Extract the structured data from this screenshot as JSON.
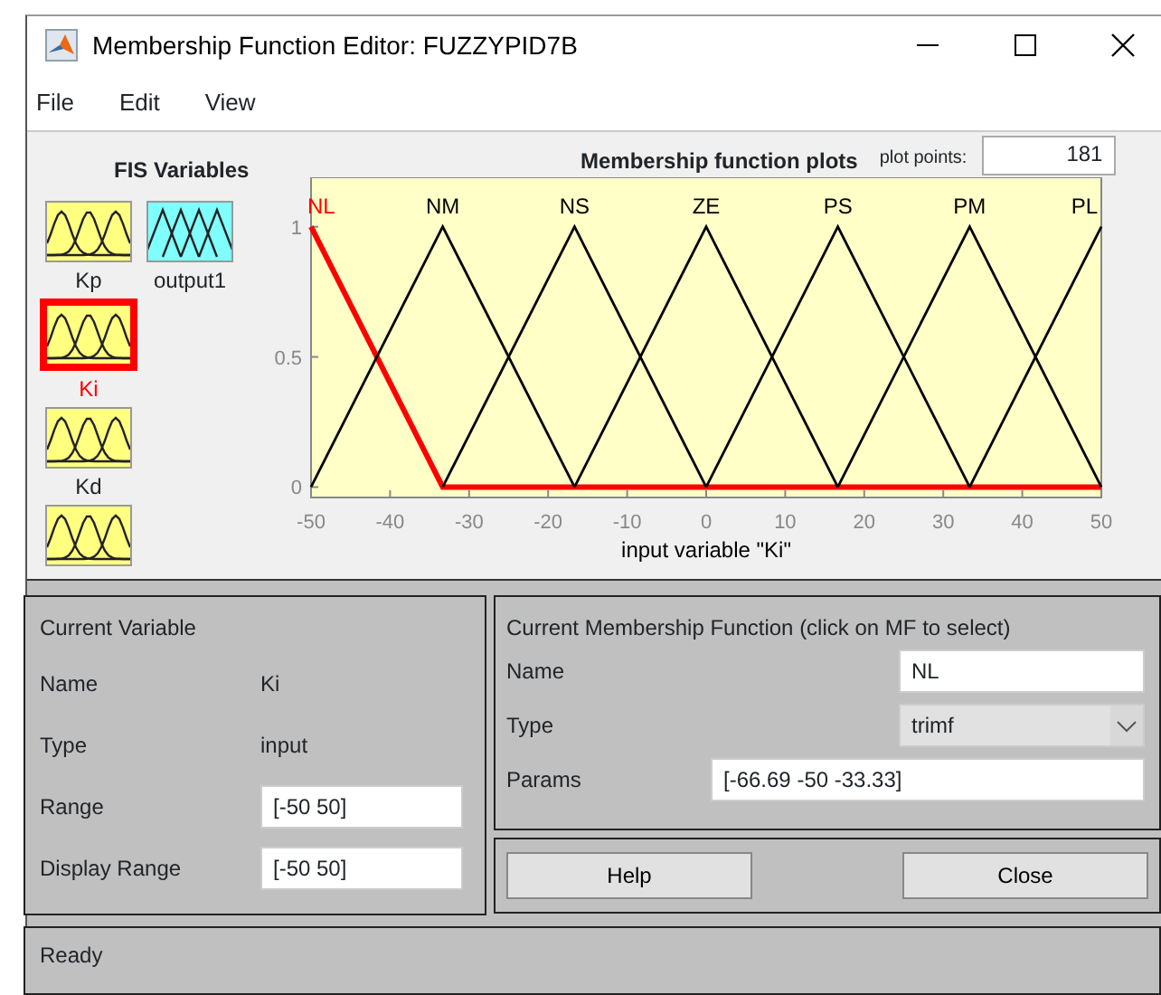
{
  "window": {
    "title": "Membership Function Editor: FUZZYPID7B"
  },
  "menu": [
    {
      "label": "File"
    },
    {
      "label": "Edit"
    },
    {
      "label": "View"
    }
  ],
  "fis_variables": {
    "title": "FIS Variables",
    "items": [
      {
        "label": "Kp",
        "kind": "input",
        "selected": false
      },
      {
        "label": "output1",
        "kind": "output",
        "selected": false
      },
      {
        "label": "Ki",
        "kind": "input",
        "selected": true
      },
      {
        "label": "Kd",
        "kind": "input",
        "selected": false
      },
      {
        "kind": "input",
        "selected": false
      }
    ]
  },
  "plot": {
    "plot_points_label": "plot points:",
    "plot_points": "181",
    "chart_data": {
      "type": "line",
      "title": "Membership function plots",
      "xlabel": "input variable \"Ki\"",
      "x": [
        -50,
        -33.33,
        -16.67,
        0,
        16.67,
        33.33,
        50
      ],
      "series": [
        {
          "name": "NL",
          "color": "#ff0000",
          "values": [
            1,
            0,
            0,
            0,
            0,
            0,
            0
          ]
        },
        {
          "name": "NM",
          "color": "#000000",
          "values": [
            0,
            1,
            0,
            null,
            null,
            null,
            null
          ]
        },
        {
          "name": "NS",
          "color": "#000000",
          "values": [
            null,
            0,
            1,
            0,
            null,
            null,
            null
          ]
        },
        {
          "name": "ZE",
          "color": "#000000",
          "values": [
            null,
            null,
            0,
            1,
            0,
            null,
            null
          ]
        },
        {
          "name": "PS",
          "color": "#000000",
          "values": [
            null,
            null,
            null,
            0,
            1,
            0,
            null
          ]
        },
        {
          "name": "PM",
          "color": "#000000",
          "values": [
            null,
            null,
            null,
            null,
            0,
            1,
            0
          ]
        },
        {
          "name": "PL",
          "color": "#000000",
          "values": [
            null,
            null,
            null,
            null,
            null,
            0,
            1
          ]
        }
      ],
      "xlim": [
        -50,
        50
      ],
      "ylim": [
        -0.04,
        1.19
      ],
      "xticks": [
        -50,
        -40,
        -30,
        -20,
        -10,
        0,
        10,
        20,
        30,
        40,
        50
      ],
      "yticks": [
        0,
        0.5,
        1
      ]
    }
  },
  "current_variable": {
    "title": "Current Variable",
    "name_label": "Name",
    "name": "Ki",
    "type_label": "Type",
    "type": "input",
    "range_label": "Range",
    "range": "[-50 50]",
    "display_range_label": "Display Range",
    "display_range": "[-50 50]"
  },
  "current_mf": {
    "title": "Current Membership Function (click on MF to select)",
    "name_label": "Name",
    "name": "NL",
    "type_label": "Type",
    "type": "trimf",
    "params_label": "Params",
    "params": "[-66.69 -50 -33.33]"
  },
  "buttons": [
    {
      "label": "Help"
    },
    {
      "label": "Close"
    }
  ],
  "status_bar": "Ready"
}
